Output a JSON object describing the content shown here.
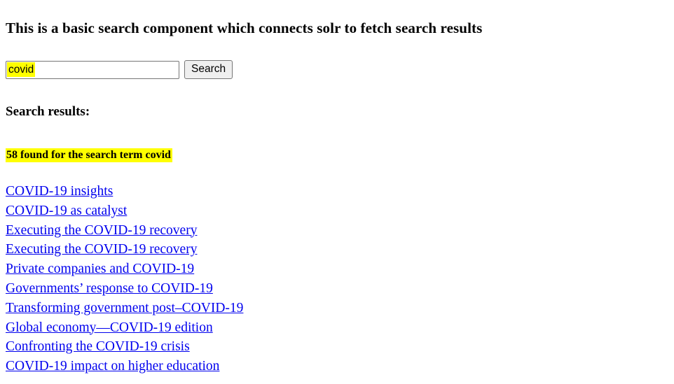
{
  "page": {
    "heading": "This is a basic search component which connects solr to fetch search results",
    "background_color": "#ffffff",
    "text_color": "#000000"
  },
  "search": {
    "input_value": "covid",
    "input_placeholder": "",
    "button_label": "Search",
    "highlight_color": "#ffff00",
    "input_border_color": "#767676",
    "button_background": "#efefef"
  },
  "results": {
    "heading": "Search results:",
    "count": 58,
    "search_term": "covid",
    "summary": "58 found for the search term covid",
    "summary_highlight_color": "#ffff00",
    "link_color": "#0000ee",
    "items": [
      {
        "title": "COVID-19 insights"
      },
      {
        "title": "COVID-19 as catalyst"
      },
      {
        "title": "Executing the COVID-19 recovery"
      },
      {
        "title": "Executing the COVID-19 recovery"
      },
      {
        "title": "Private companies and COVID-19"
      },
      {
        "title": "Governments’ response to COVID-19"
      },
      {
        "title": "Transforming government post–COVID-19"
      },
      {
        "title": "Global economy—COVID-19 edition"
      },
      {
        "title": "Confronting the COVID-19 crisis"
      },
      {
        "title": "COVID-19 impact on higher education"
      }
    ]
  }
}
